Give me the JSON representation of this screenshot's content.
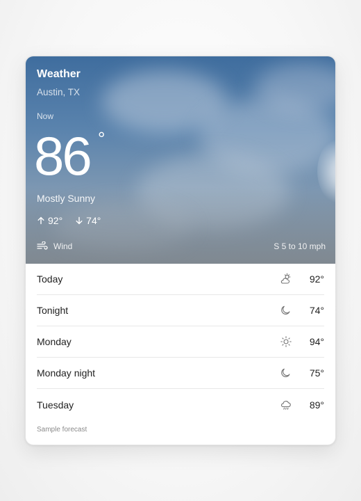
{
  "header": {
    "title": "Weather",
    "location": "Austin, TX",
    "now_label": "Now",
    "temperature": "86",
    "degree_symbol": "°",
    "condition": "Mostly Sunny",
    "high": "92°",
    "low": "74°"
  },
  "wind": {
    "label": "Wind",
    "value": "S 5 to 10 mph"
  },
  "forecast": [
    {
      "label": "Today",
      "icon": "partly-sunny-icon",
      "temp": "92°"
    },
    {
      "label": "Tonight",
      "icon": "moon-icon",
      "temp": "74°"
    },
    {
      "label": "Monday",
      "icon": "sun-icon",
      "temp": "94°"
    },
    {
      "label": "Monday night",
      "icon": "moon-icon",
      "temp": "75°"
    },
    {
      "label": "Tuesday",
      "icon": "rain-cloud-icon",
      "temp": "89°"
    }
  ],
  "footnote": "Sample forecast"
}
